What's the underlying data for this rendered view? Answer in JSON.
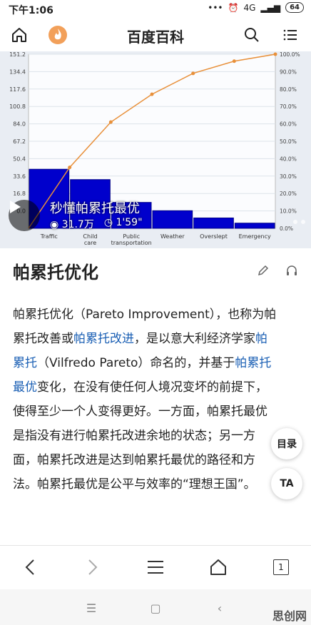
{
  "status_bar": {
    "time": "下午1:06",
    "signal": "4G",
    "battery": "64"
  },
  "header": {
    "title": "百度百科"
  },
  "video": {
    "title": "秒懂帕累托最优",
    "views": "31.7万",
    "duration": "1'59\"",
    "chart_data": {
      "type": "bar",
      "categories": [
        "Traffic",
        "Child care",
        "Public transportation",
        "Weather",
        "Overslept",
        "Emergency"
      ],
      "values": [
        57,
        47,
        25,
        17,
        10,
        5
      ],
      "cumulative_percent": [
        35,
        61,
        77,
        89,
        96,
        100
      ],
      "y_ticks_left": [
        "151.2",
        "134.4",
        "117.6",
        "100.8",
        "84.0",
        "67.2",
        "50.4",
        "33.6",
        "16.8",
        "0.0"
      ],
      "y_ticks_right": [
        "100.0%",
        "90.0%",
        "80.0%",
        "70.0%",
        "60.0%",
        "50.0%",
        "40.0%",
        "30.0%",
        "20.0%",
        "10.0%",
        "0.0%"
      ],
      "ylim": [
        0,
        168
      ],
      "bar_color": "#0000cc",
      "line_color": "#e8903a"
    }
  },
  "entry": {
    "title": "帕累托优化",
    "paragraph": [
      {
        "t": "帕累托优化（Pareto Improvement），也称为帕累托改善或",
        "link": false
      },
      {
        "t": "帕累托改进",
        "link": true
      },
      {
        "t": "，是以意大利经济学家",
        "link": false
      },
      {
        "t": "帕累托",
        "link": true
      },
      {
        "t": "（Vilfredo Pareto）命名的，并基于",
        "link": false
      },
      {
        "t": "帕累托最优",
        "link": true
      },
      {
        "t": "变化，在没有使任何人境况变坏的前提下，使得至少一个人变得更好。一方面，帕累托最优是指没有进行帕累托改进余地的状态；另一方面，帕累托改进是达到帕累托最优的路径和方法。帕累托最优是公平与效率的“理想王国”。",
        "link": false
      }
    ]
  },
  "floating": {
    "toc": "目录",
    "font": "TA"
  },
  "bottom_nav": {
    "page_count": "1"
  },
  "watermark": "思创网"
}
